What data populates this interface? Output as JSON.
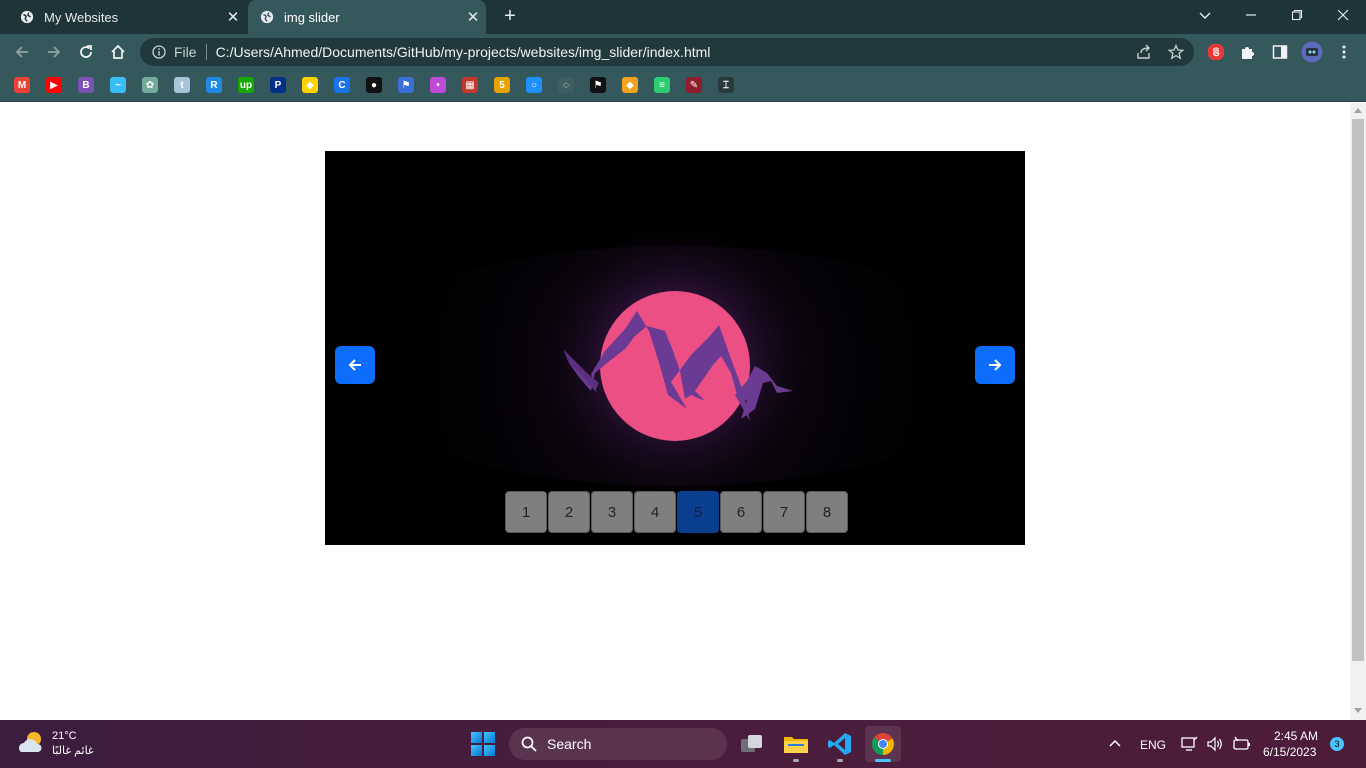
{
  "browser": {
    "tabs": [
      {
        "title": "My Websites",
        "active": false
      },
      {
        "title": "img slider",
        "active": true
      }
    ],
    "new_tab_label": "+",
    "close_glyph": "✕",
    "omnibox": {
      "scheme_label": "File",
      "url": "C:/Users/Ahmed/Documents/GitHub/my-projects/websites/img_slider/index.html"
    },
    "bookmarks": [
      {
        "icon": "gmail-icon",
        "glyph": "M",
        "color": "#ea4335"
      },
      {
        "icon": "youtube-icon",
        "glyph": "▶",
        "color": "#ff0000"
      },
      {
        "icon": "bootstrap-icon",
        "glyph": "B",
        "color": "#7952b3"
      },
      {
        "icon": "tailwind-icon",
        "glyph": "~",
        "color": "#38bdf8"
      },
      {
        "icon": "chatgpt-icon",
        "glyph": "✿",
        "color": "#74aa9c"
      },
      {
        "icon": "tumblr-icon",
        "glyph": "t",
        "color": "#a8c4d8"
      },
      {
        "icon": "figma-r-icon",
        "glyph": "R",
        "color": "#1e88e5"
      },
      {
        "icon": "upwork-icon",
        "glyph": "up",
        "color": "#14a800"
      },
      {
        "icon": "paypal-icon",
        "glyph": "P",
        "color": "#003087"
      },
      {
        "icon": "shield-icon",
        "glyph": "◆",
        "color": "#ffd200"
      },
      {
        "icon": "c-icon",
        "glyph": "C",
        "color": "#1a73e8"
      },
      {
        "icon": "github-icon",
        "glyph": "●",
        "color": "#111111"
      },
      {
        "icon": "flag-icon",
        "glyph": "⚑",
        "color": "#3a6fd8"
      },
      {
        "icon": "chat-icon",
        "glyph": "•",
        "color": "#c04ad8"
      },
      {
        "icon": "grid-icon",
        "glyph": "▦",
        "color": "#c0392b"
      },
      {
        "icon": "five-icon",
        "glyph": "5",
        "color": "#e6a200"
      },
      {
        "icon": "circle-icon",
        "glyph": "○",
        "color": "#1e90ff"
      },
      {
        "icon": "blank-icon",
        "glyph": "◌",
        "color": "#3e5e61"
      },
      {
        "icon": "pennant-icon",
        "glyph": "⚑",
        "color": "#111111"
      },
      {
        "icon": "diamond-icon",
        "glyph": "◆",
        "color": "#f4a21d"
      },
      {
        "icon": "lines-icon",
        "glyph": "≡",
        "color": "#2ecc71"
      },
      {
        "icon": "pen-icon",
        "glyph": "✎",
        "color": "#8e1e2d"
      },
      {
        "icon": "bracket-icon",
        "glyph": "⌶",
        "color": "#2a3a3c"
      }
    ]
  },
  "slider": {
    "prev_icon": "arrow-left-icon",
    "next_icon": "arrow-right-icon",
    "pages": [
      "1",
      "2",
      "3",
      "4",
      "5",
      "6",
      "7",
      "8"
    ],
    "active_page": "5",
    "accent": "#0d6efd",
    "image": "mountain-sunset"
  },
  "taskbar": {
    "weather": {
      "temp": "21°C",
      "condition": "غائم غالبًا"
    },
    "search_label": "Search",
    "language": "ENG",
    "time": "2:45 AM",
    "date": "6/15/2023",
    "notifications": "3"
  }
}
